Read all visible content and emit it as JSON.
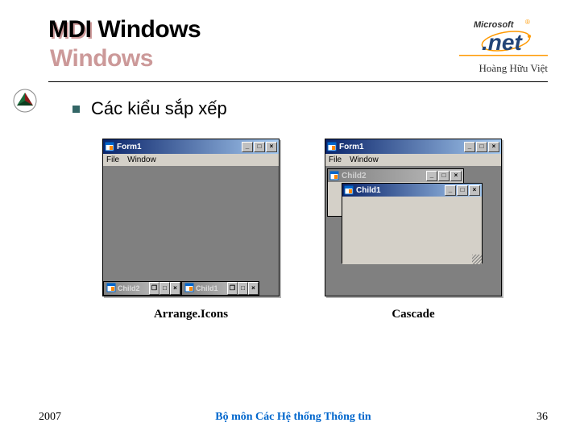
{
  "header": {
    "title": "MDI Windows",
    "logo_text_top": "Microsoft",
    "logo_text_bottom": ".net",
    "author": "Hoàng Hữu Việt"
  },
  "content": {
    "bullet1": "Các kiểu sắp xếp",
    "panels": [
      {
        "caption": "Arrange.Icons"
      },
      {
        "caption": "Cascade"
      }
    ]
  },
  "mdi_parent": {
    "title": "Form1",
    "menu": {
      "file": "File",
      "window": "Window"
    }
  },
  "children": {
    "child1": "Child1",
    "child2": "Child2"
  },
  "win_buttons": {
    "minimize": "_",
    "maximize": "□",
    "restore": "❐",
    "close": "×"
  },
  "footer": {
    "year": "2007",
    "center": "Bộ môn Các Hệ thống Thông tin",
    "page": "36"
  }
}
